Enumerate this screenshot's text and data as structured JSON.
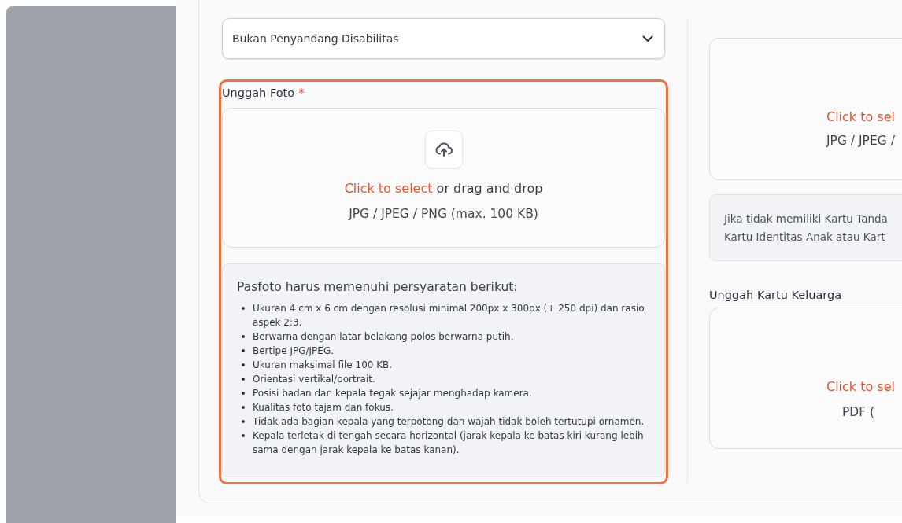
{
  "disability_select": {
    "value": "Bukan Penyandang Disabilitas"
  },
  "photo_upload": {
    "label": "Unggah Foto",
    "required_mark": "*",
    "highlighted": true,
    "link": "Click to select",
    "prompt_rest": "or drag and drop",
    "formats": "JPG / JPEG / PNG (max. 100 KB)",
    "requirements_title": "Pasfoto harus memenuhi persyaratan berikut:",
    "requirements": [
      "Ukuran 4 cm x 6 cm dengan resolusi minimal 200px x 300px (+ 250 dpi) dan rasio aspek 2:3.",
      "Berwarna dengan latar belakang polos berwarna putih.",
      "Bertipe JPG/JPEG.",
      "Ukuran maksimal file 100 KB.",
      "Orientasi vertikal/portrait.",
      "Posisi badan dan kepala tegak sejajar menghadap kamera.",
      "Kualitas foto tajam dan fokus.",
      "Tidak ada bagian kepala yang terpotong dan wajah tidak boleh tertutupi ornamen.",
      "Kepala terletak di tengah secara horizontal (jarak kepala ke batas kiri kurang lebih sama dengan jarak kepala ke batas kanan)."
    ]
  },
  "ktp_upload": {
    "link": "Click to sel",
    "formats": "JPG / JPEG /",
    "note_lines": [
      "Jika tidak memiliki Kartu Tanda",
      "Kartu Identitas Anak atau Kart"
    ]
  },
  "kk_upload": {
    "label": "Unggah Kartu Keluarga",
    "link": "Click to sel",
    "formats": "PDF ("
  }
}
